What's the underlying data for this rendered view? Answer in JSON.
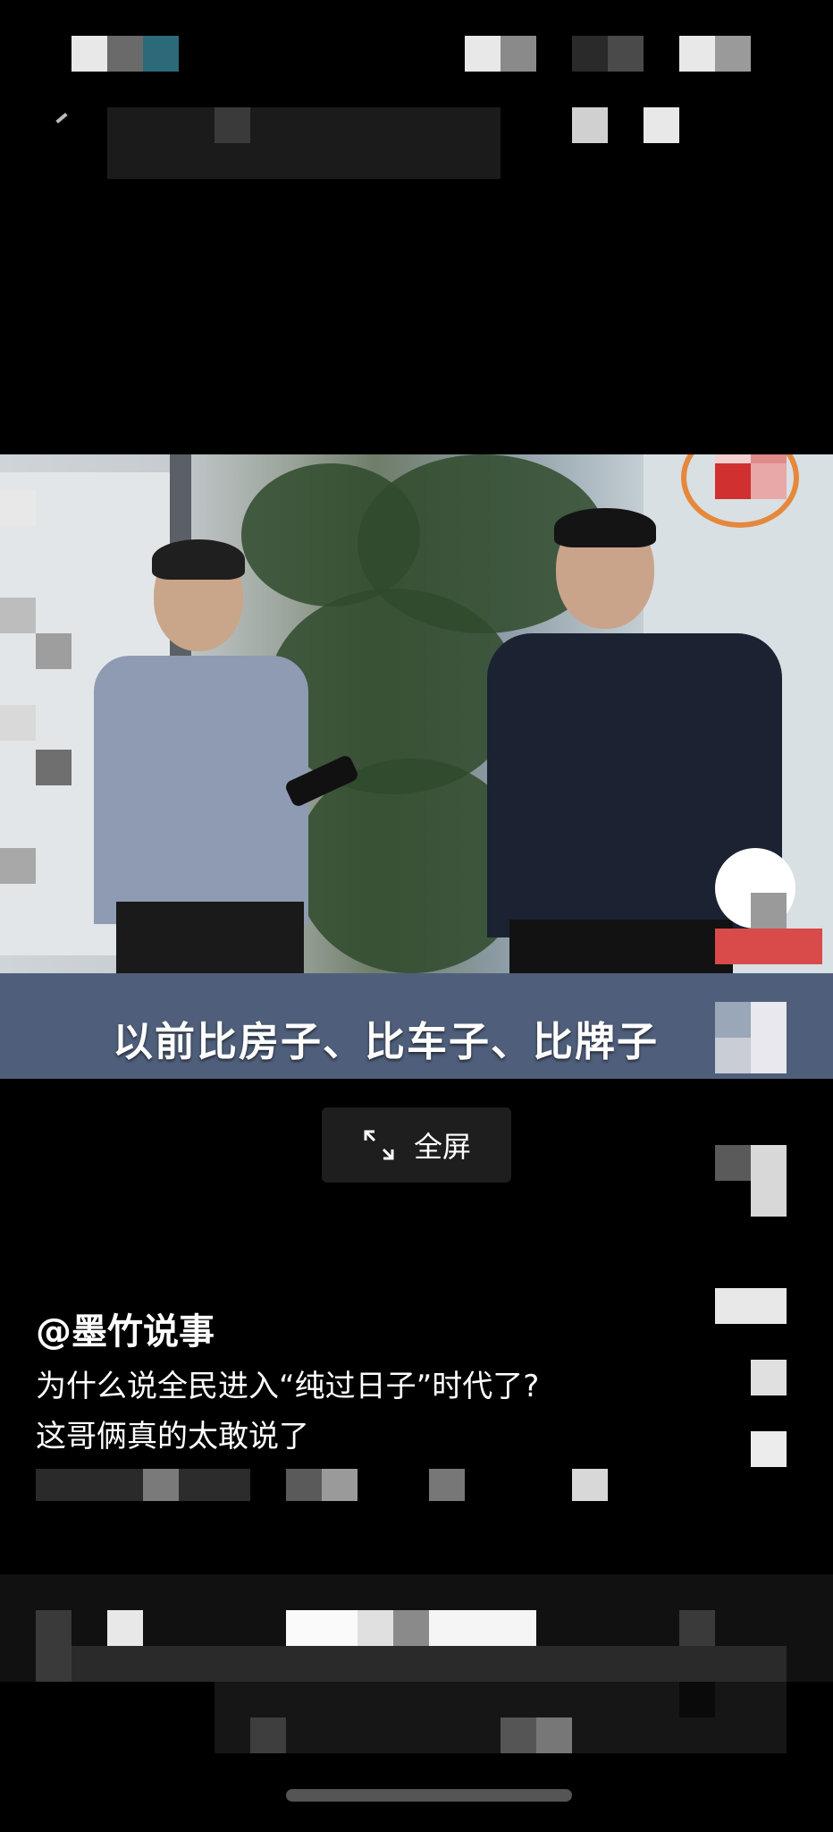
{
  "video": {
    "caption": "以前比房子、比车子、比牌子",
    "fullscreen_label": "全屏"
  },
  "post": {
    "author": "@墨竹说事",
    "description_line1": "为什么说全民进入“纯过日子”时代了?",
    "description_line2": "这哥俩真的太敢说了"
  },
  "icons": {
    "fullscreen": "expand-arrows-icon"
  },
  "colors": {
    "caption_bar": "#4f5f7b",
    "fullscreen_button": "#1e1e1e",
    "background": "#000000"
  }
}
